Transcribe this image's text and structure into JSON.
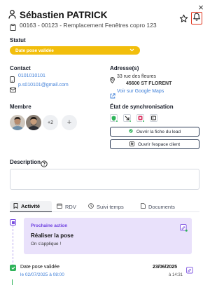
{
  "header": {
    "title": "Sébastien PATRICK",
    "subtitle": "00163 - 00123 - Remplacement Fenêtres copro 123",
    "close_icon": "×"
  },
  "statut": {
    "label": "Statut",
    "value": "Date pose validée",
    "color": "#f2be0c"
  },
  "contact": {
    "label": "Contact",
    "phone": "0101010101",
    "email": "p.s010101@gmail.com"
  },
  "address": {
    "label": "Adresse(s)",
    "line1": "33 rue des fleures",
    "line2": "45600 ST FLORENT",
    "maps_link": "Voir sur Google Maps"
  },
  "membre": {
    "label": "Membre",
    "extra_count": "+2",
    "add_symbol": "+"
  },
  "sync": {
    "label": "État de synchronisation",
    "open_lead": "Ouvrir la fiche du lead",
    "open_client": "Ouvrir l'espace client"
  },
  "description": {
    "label": "Description"
  },
  "tabs": [
    {
      "label": "Activité",
      "icon": "bookmark-icon",
      "active": true
    },
    {
      "label": "RDV",
      "icon": "calendar-icon",
      "active": false
    },
    {
      "label": "Suivi temps",
      "icon": "clock-icon",
      "active": false
    },
    {
      "label": "Documents",
      "icon": "document-icon",
      "active": false
    }
  ],
  "next_action": {
    "label": "Prochaine action",
    "title": "Réaliser la pose",
    "subtitle": "On s'applique !",
    "accent": "#7a4fe0"
  },
  "events": [
    {
      "title": "Date pose validée",
      "date": "le 02/07/2025 à 08:00",
      "right_date": "23/06/2025",
      "right_time": "à 14:31"
    }
  ]
}
